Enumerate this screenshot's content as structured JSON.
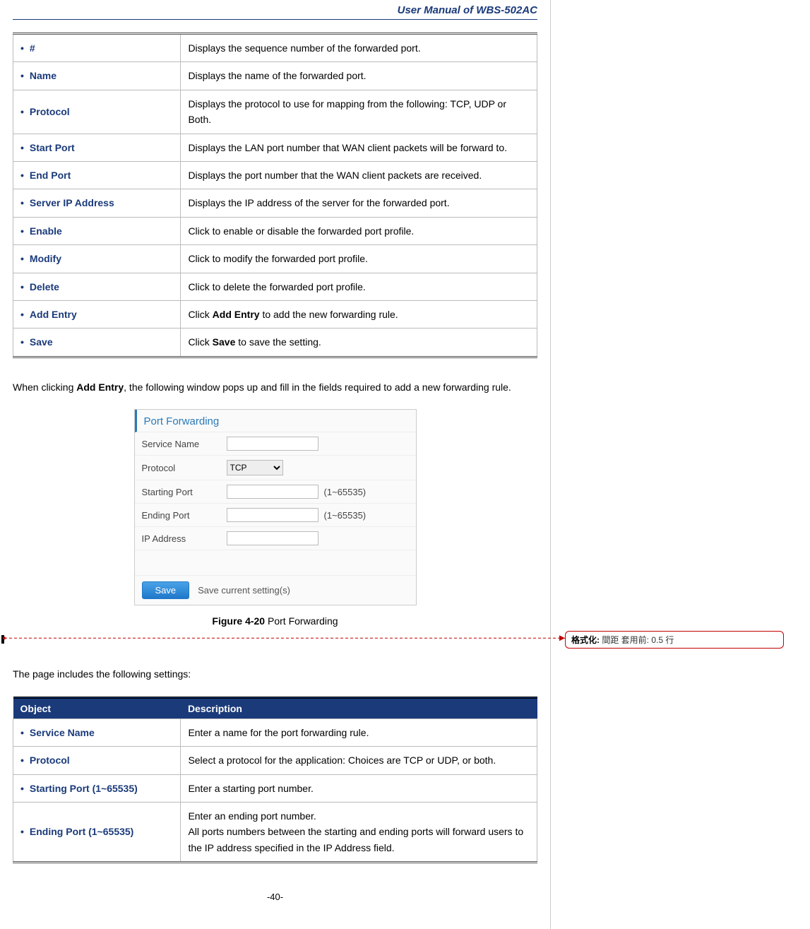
{
  "header": {
    "title": "User  Manual  of  WBS-502AC"
  },
  "table1_rows": [
    {
      "obj": "#",
      "desc_plain": "Displays the sequence number of the forwarded port."
    },
    {
      "obj": "Name",
      "desc_plain": "Displays the name of the forwarded port."
    },
    {
      "obj": "Protocol",
      "desc_plain": "Displays the protocol to use for mapping from the following: TCP, UDP or Both."
    },
    {
      "obj": "Start Port",
      "desc_plain": "Displays the LAN port number that WAN client packets will be forward to."
    },
    {
      "obj": "End Port",
      "desc_plain": "Displays the port number that the WAN client packets are received."
    },
    {
      "obj": "Server IP Address",
      "desc_plain": "Displays the IP address of the server for the forwarded port."
    },
    {
      "obj": "Enable",
      "desc_plain": "Click to enable or disable the forwarded port profile."
    },
    {
      "obj": "Modify",
      "desc_plain": "Click to modify the forwarded port profile."
    },
    {
      "obj": "Delete",
      "desc_plain": "Click to delete the forwarded port profile."
    },
    {
      "obj": "Add Entry",
      "desc_before": "Click ",
      "desc_bold": "Add Entry",
      "desc_after": " to add the new forwarding rule."
    },
    {
      "obj": "Save",
      "desc_before": "Click ",
      "desc_bold": "Save",
      "desc_after": " to save the setting."
    }
  ],
  "paragraph_add_entry": {
    "before": "When clicking ",
    "bold": "Add Entry",
    "after": ", the following window pops up and fill in the fields required to add a new forwarding rule."
  },
  "port_forwarding_form": {
    "title": "Port Forwarding",
    "rows": {
      "service_name": "Service Name",
      "protocol": "Protocol",
      "protocol_value": "TCP",
      "starting_port": "Starting Port",
      "ending_port": "Ending Port",
      "ip_address": "IP Address",
      "range_hint": "(1~65535)"
    },
    "save_button": "Save",
    "save_desc": "Save current setting(s)"
  },
  "figure_caption": {
    "bold": "Figure 4-20",
    "rest": " Port Forwarding"
  },
  "paragraph_includes": "The page includes the following settings:",
  "table2_header": {
    "object": "Object",
    "description": "Description"
  },
  "table2_rows": [
    {
      "obj": "Service Name",
      "desc_plain": "Enter a name for the port forwarding rule."
    },
    {
      "obj": "Protocol",
      "desc_plain": "Select a protocol for the application: Choices are TCP or UDP, or both."
    },
    {
      "obj": "Starting Port (1~65535)",
      "desc_plain": "Enter a starting port number."
    },
    {
      "obj": "Ending Port (1~65535)",
      "desc_plain": "Enter an ending port number.\nAll  ports  numbers  between  the  starting  and  ending  ports  will  forward users to the IP address specified in the IP Address field."
    }
  ],
  "comment": {
    "label": "格式化:",
    "text": " 間距 套用前:  0.5 行"
  },
  "page_number": "-40-"
}
